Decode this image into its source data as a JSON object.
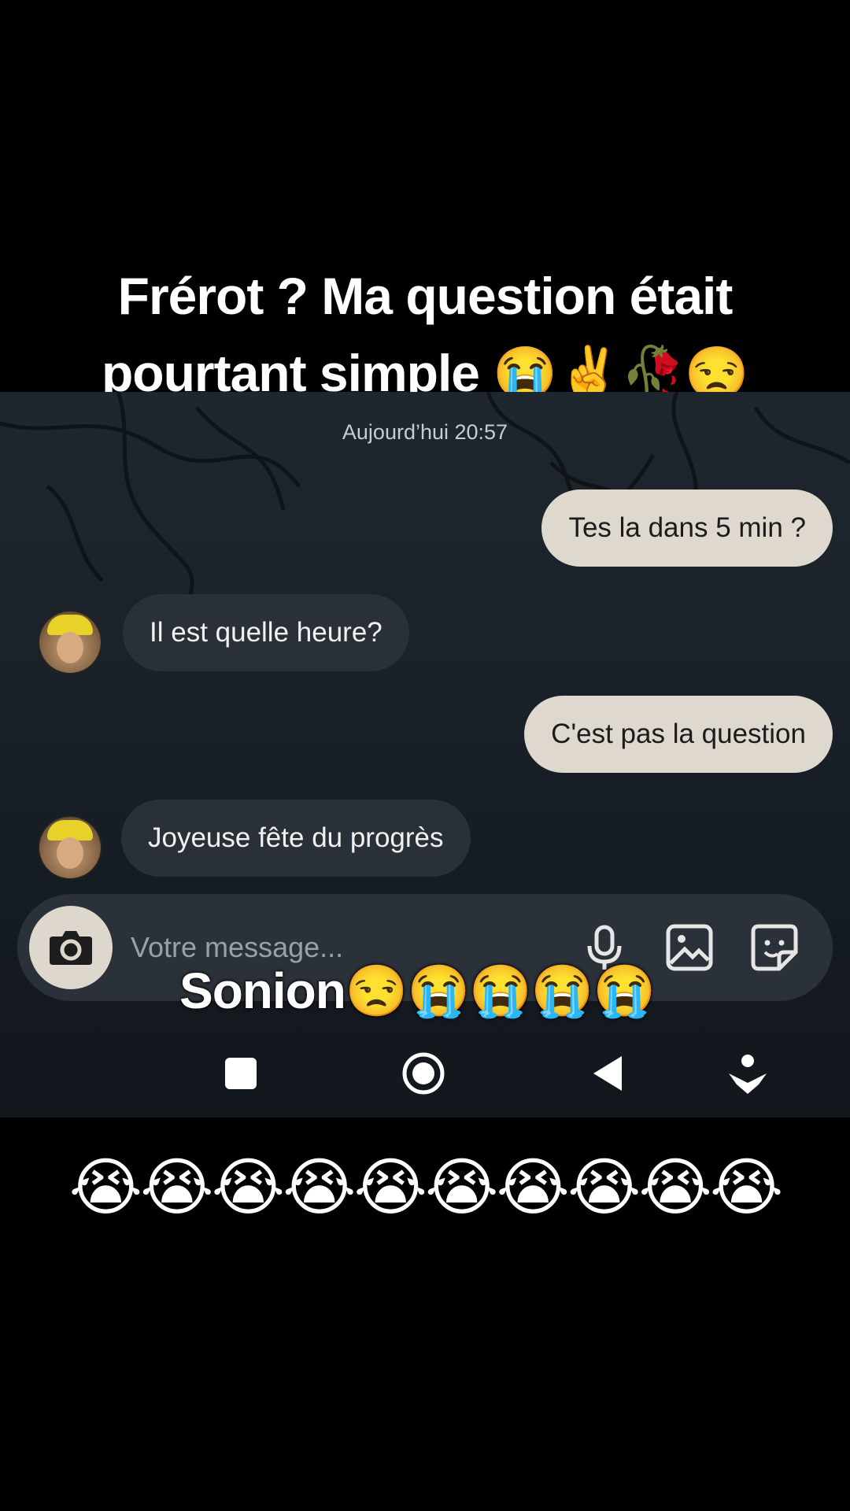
{
  "video_caption": {
    "line1": "Frérot ? Ma question était",
    "line2": "pourtant simple 😭✌️🥀😒"
  },
  "chat": {
    "timestamp": "Aujourd’hui 20:57",
    "messages": [
      {
        "direction": "outgoing",
        "text": "Tes la dans 5 min ?"
      },
      {
        "direction": "incoming",
        "text": "Il est quelle heure?"
      },
      {
        "direction": "outgoing",
        "text": "C'est pas la question"
      },
      {
        "direction": "incoming",
        "text": "Joyeuse fête du progrès"
      }
    ]
  },
  "composer": {
    "placeholder": "Votre message...",
    "icons": [
      "camera-icon",
      "microphone-icon",
      "gallery-icon",
      "sticker-icon"
    ]
  },
  "overlay_caption": "Sonion😒😭😭😭😭",
  "navigation_bar": {
    "icons": [
      "recents-icon",
      "home-icon",
      "back-icon",
      "assistant-icon"
    ]
  },
  "bottom_caption": "😭😭😭😭😭😭😭😭😭😭",
  "colors": {
    "outgoing_bubble": "#ded8cf",
    "incoming_bubble": "#2a3038",
    "composer": "#2b3138",
    "background": "#000000"
  }
}
